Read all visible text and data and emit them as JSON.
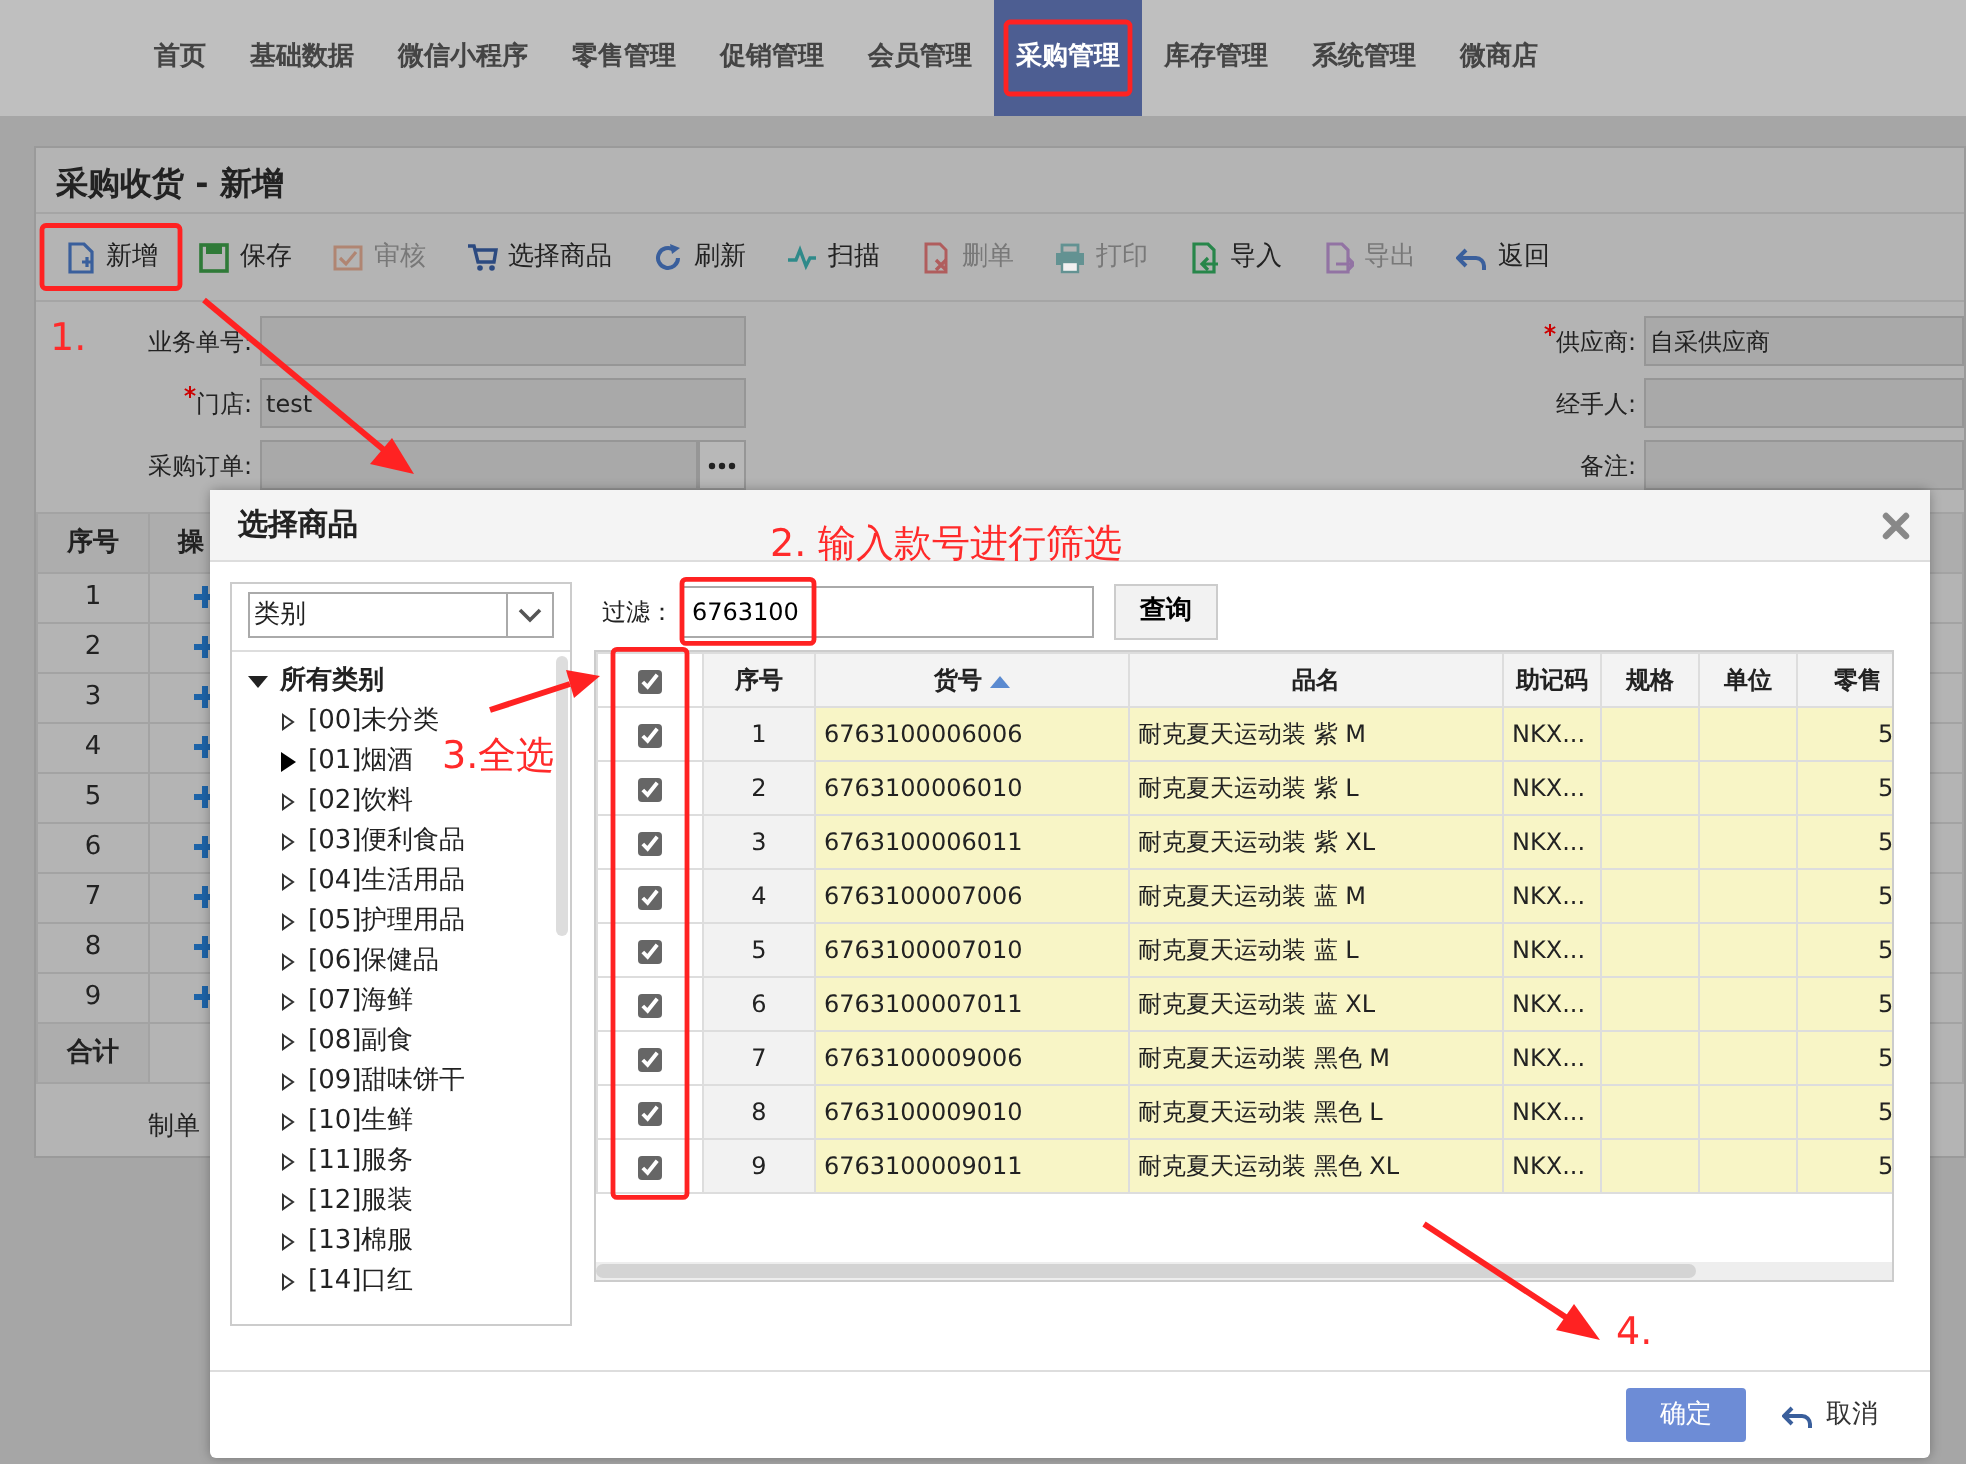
{
  "top_nav": [
    {
      "label": "首页",
      "selected": false
    },
    {
      "label": "基础数据",
      "selected": false
    },
    {
      "label": "微信小程序",
      "selected": false
    },
    {
      "label": "零售管理",
      "selected": false
    },
    {
      "label": "促销管理",
      "selected": false
    },
    {
      "label": "会员管理",
      "selected": false
    },
    {
      "label": "采购管理",
      "selected": true
    },
    {
      "label": "库存管理",
      "selected": false
    },
    {
      "label": "系统管理",
      "selected": false
    },
    {
      "label": "微商店",
      "selected": false
    }
  ],
  "page": {
    "title": "采购收货 - 新增",
    "toolbar": [
      {
        "label": "新增",
        "kind": "new",
        "disabled": false
      },
      {
        "label": "保存",
        "kind": "save",
        "disabled": false
      },
      {
        "label": "审核",
        "kind": "audit",
        "disabled": true
      },
      {
        "label": "选择商品",
        "kind": "cart",
        "disabled": false
      },
      {
        "label": "刷新",
        "kind": "refresh",
        "disabled": false
      },
      {
        "label": "扫描",
        "kind": "scan",
        "disabled": false
      },
      {
        "label": "删单",
        "kind": "delete",
        "disabled": true
      },
      {
        "label": "打印",
        "kind": "print",
        "disabled": true
      },
      {
        "label": "导入",
        "kind": "import",
        "disabled": false
      },
      {
        "label": "导出",
        "kind": "export",
        "disabled": true
      },
      {
        "label": "返回",
        "kind": "back",
        "disabled": false
      }
    ],
    "form_left": [
      {
        "label": "业务单号:",
        "required": false,
        "kind": "text"
      },
      {
        "label": "门店:",
        "required": true,
        "kind": "text",
        "value": "test"
      },
      {
        "label": "采购订单:",
        "required": false,
        "kind": "picker"
      }
    ],
    "form_right": [
      {
        "label": "供应商:",
        "required": true,
        "value": "自采供应商"
      },
      {
        "label": "经手人:",
        "required": false
      },
      {
        "label": "备注:",
        "required": false
      }
    ],
    "grid": {
      "columns": [
        "序号",
        "操"
      ],
      "rows": [
        "1",
        "2",
        "3",
        "4",
        "5",
        "6",
        "7",
        "8",
        "9"
      ],
      "total_label": "合计"
    },
    "footer": "制单"
  },
  "modal": {
    "title": "选择商品",
    "category_select": "类别",
    "tree": {
      "label": "所有类别",
      "expanded": true,
      "children": [
        {
          "label": "[00]未分类",
          "active": false
        },
        {
          "label": "[01]烟酒",
          "active": true
        },
        {
          "label": "[02]饮料",
          "active": false
        },
        {
          "label": "[03]便利食品",
          "active": false
        },
        {
          "label": "[04]生活用品",
          "active": false
        },
        {
          "label": "[05]护理用品",
          "active": false
        },
        {
          "label": "[06]保健品",
          "active": false
        },
        {
          "label": "[07]海鲜",
          "active": false
        },
        {
          "label": "[08]副食",
          "active": false
        },
        {
          "label": "[09]甜味饼干",
          "active": false
        },
        {
          "label": "[10]生鲜",
          "active": false
        },
        {
          "label": "[11]服务",
          "active": false
        },
        {
          "label": "[12]服装",
          "active": false
        },
        {
          "label": "[13]棉服",
          "active": false
        },
        {
          "label": "[14]口红",
          "active": false
        }
      ]
    },
    "filter_label": "过滤：",
    "filter_value": "6763100",
    "query_button": "查询",
    "select_all": true,
    "columns": [
      {
        "label": "序号",
        "sorted": false
      },
      {
        "label": "货号",
        "sorted": true
      },
      {
        "label": "品名",
        "sorted": false
      },
      {
        "label": "助记码",
        "sorted": false
      },
      {
        "label": "规格",
        "sorted": false
      },
      {
        "label": "单位",
        "sorted": false
      },
      {
        "label": "零售",
        "sorted": false
      }
    ],
    "rows": [
      {
        "checked": true,
        "index": "1",
        "code": "6763100006006",
        "name": "耐克夏天运动装 紫 M",
        "mnemonic": "NKX...",
        "price": "5"
      },
      {
        "checked": true,
        "index": "2",
        "code": "6763100006010",
        "name": "耐克夏天运动装 紫 L",
        "mnemonic": "NKX...",
        "price": "5"
      },
      {
        "checked": true,
        "index": "3",
        "code": "6763100006011",
        "name": "耐克夏天运动装 紫 XL",
        "mnemonic": "NKX...",
        "price": "5"
      },
      {
        "checked": true,
        "index": "4",
        "code": "6763100007006",
        "name": "耐克夏天运动装 蓝 M",
        "mnemonic": "NKX...",
        "price": "5"
      },
      {
        "checked": true,
        "index": "5",
        "code": "6763100007010",
        "name": "耐克夏天运动装 蓝 L",
        "mnemonic": "NKX...",
        "price": "5"
      },
      {
        "checked": true,
        "index": "6",
        "code": "6763100007011",
        "name": "耐克夏天运动装 蓝 XL",
        "mnemonic": "NKX...",
        "price": "5"
      },
      {
        "checked": true,
        "index": "7",
        "code": "6763100009006",
        "name": "耐克夏天运动装 黑色 M",
        "mnemonic": "NKX...",
        "price": "5"
      },
      {
        "checked": true,
        "index": "8",
        "code": "6763100009010",
        "name": "耐克夏天运动装 黑色 L",
        "mnemonic": "NKX...",
        "price": "5"
      },
      {
        "checked": true,
        "index": "9",
        "code": "6763100009011",
        "name": "耐克夏天运动装 黑色 XL",
        "mnemonic": "NKX...",
        "price": "5"
      }
    ],
    "ok_button": "确定",
    "cancel_button": "取消"
  },
  "annotations": [
    "1.",
    "2. 输入款号进行筛选",
    "3.全选",
    "4."
  ]
}
